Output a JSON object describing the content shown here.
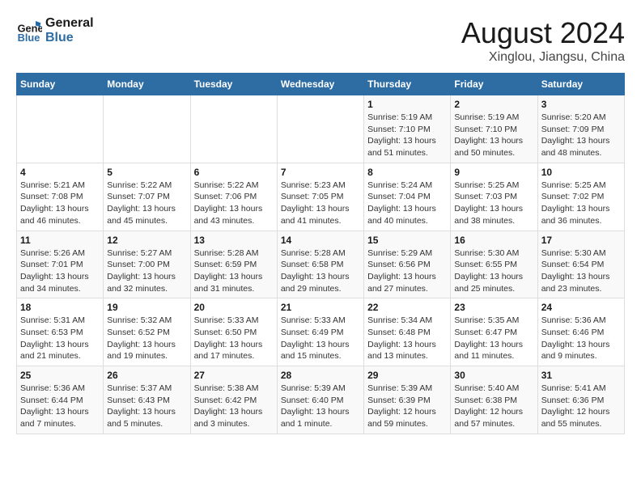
{
  "logo": {
    "line1": "General",
    "line2": "Blue"
  },
  "title": "August 2024",
  "location": "Xinglou, Jiangsu, China",
  "weekdays": [
    "Sunday",
    "Monday",
    "Tuesday",
    "Wednesday",
    "Thursday",
    "Friday",
    "Saturday"
  ],
  "weeks": [
    [
      {
        "day": "",
        "info": ""
      },
      {
        "day": "",
        "info": ""
      },
      {
        "day": "",
        "info": ""
      },
      {
        "day": "",
        "info": ""
      },
      {
        "day": "1",
        "sunrise": "5:19 AM",
        "sunset": "7:10 PM",
        "daylight": "13 hours and 51 minutes."
      },
      {
        "day": "2",
        "sunrise": "5:19 AM",
        "sunset": "7:10 PM",
        "daylight": "13 hours and 50 minutes."
      },
      {
        "day": "3",
        "sunrise": "5:20 AM",
        "sunset": "7:09 PM",
        "daylight": "13 hours and 48 minutes."
      }
    ],
    [
      {
        "day": "4",
        "sunrise": "5:21 AM",
        "sunset": "7:08 PM",
        "daylight": "13 hours and 46 minutes."
      },
      {
        "day": "5",
        "sunrise": "5:22 AM",
        "sunset": "7:07 PM",
        "daylight": "13 hours and 45 minutes."
      },
      {
        "day": "6",
        "sunrise": "5:22 AM",
        "sunset": "7:06 PM",
        "daylight": "13 hours and 43 minutes."
      },
      {
        "day": "7",
        "sunrise": "5:23 AM",
        "sunset": "7:05 PM",
        "daylight": "13 hours and 41 minutes."
      },
      {
        "day": "8",
        "sunrise": "5:24 AM",
        "sunset": "7:04 PM",
        "daylight": "13 hours and 40 minutes."
      },
      {
        "day": "9",
        "sunrise": "5:25 AM",
        "sunset": "7:03 PM",
        "daylight": "13 hours and 38 minutes."
      },
      {
        "day": "10",
        "sunrise": "5:25 AM",
        "sunset": "7:02 PM",
        "daylight": "13 hours and 36 minutes."
      }
    ],
    [
      {
        "day": "11",
        "sunrise": "5:26 AM",
        "sunset": "7:01 PM",
        "daylight": "13 hours and 34 minutes."
      },
      {
        "day": "12",
        "sunrise": "5:27 AM",
        "sunset": "7:00 PM",
        "daylight": "13 hours and 32 minutes."
      },
      {
        "day": "13",
        "sunrise": "5:28 AM",
        "sunset": "6:59 PM",
        "daylight": "13 hours and 31 minutes."
      },
      {
        "day": "14",
        "sunrise": "5:28 AM",
        "sunset": "6:58 PM",
        "daylight": "13 hours and 29 minutes."
      },
      {
        "day": "15",
        "sunrise": "5:29 AM",
        "sunset": "6:56 PM",
        "daylight": "13 hours and 27 minutes."
      },
      {
        "day": "16",
        "sunrise": "5:30 AM",
        "sunset": "6:55 PM",
        "daylight": "13 hours and 25 minutes."
      },
      {
        "day": "17",
        "sunrise": "5:30 AM",
        "sunset": "6:54 PM",
        "daylight": "13 hours and 23 minutes."
      }
    ],
    [
      {
        "day": "18",
        "sunrise": "5:31 AM",
        "sunset": "6:53 PM",
        "daylight": "13 hours and 21 minutes."
      },
      {
        "day": "19",
        "sunrise": "5:32 AM",
        "sunset": "6:52 PM",
        "daylight": "13 hours and 19 minutes."
      },
      {
        "day": "20",
        "sunrise": "5:33 AM",
        "sunset": "6:50 PM",
        "daylight": "13 hours and 17 minutes."
      },
      {
        "day": "21",
        "sunrise": "5:33 AM",
        "sunset": "6:49 PM",
        "daylight": "13 hours and 15 minutes."
      },
      {
        "day": "22",
        "sunrise": "5:34 AM",
        "sunset": "6:48 PM",
        "daylight": "13 hours and 13 minutes."
      },
      {
        "day": "23",
        "sunrise": "5:35 AM",
        "sunset": "6:47 PM",
        "daylight": "13 hours and 11 minutes."
      },
      {
        "day": "24",
        "sunrise": "5:36 AM",
        "sunset": "6:46 PM",
        "daylight": "13 hours and 9 minutes."
      }
    ],
    [
      {
        "day": "25",
        "sunrise": "5:36 AM",
        "sunset": "6:44 PM",
        "daylight": "13 hours and 7 minutes."
      },
      {
        "day": "26",
        "sunrise": "5:37 AM",
        "sunset": "6:43 PM",
        "daylight": "13 hours and 5 minutes."
      },
      {
        "day": "27",
        "sunrise": "5:38 AM",
        "sunset": "6:42 PM",
        "daylight": "13 hours and 3 minutes."
      },
      {
        "day": "28",
        "sunrise": "5:39 AM",
        "sunset": "6:40 PM",
        "daylight": "13 hours and 1 minute."
      },
      {
        "day": "29",
        "sunrise": "5:39 AM",
        "sunset": "6:39 PM",
        "daylight": "12 hours and 59 minutes."
      },
      {
        "day": "30",
        "sunrise": "5:40 AM",
        "sunset": "6:38 PM",
        "daylight": "12 hours and 57 minutes."
      },
      {
        "day": "31",
        "sunrise": "5:41 AM",
        "sunset": "6:36 PM",
        "daylight": "12 hours and 55 minutes."
      }
    ]
  ],
  "labels": {
    "sunrise": "Sunrise:",
    "sunset": "Sunset:",
    "daylight": "Daylight:"
  }
}
